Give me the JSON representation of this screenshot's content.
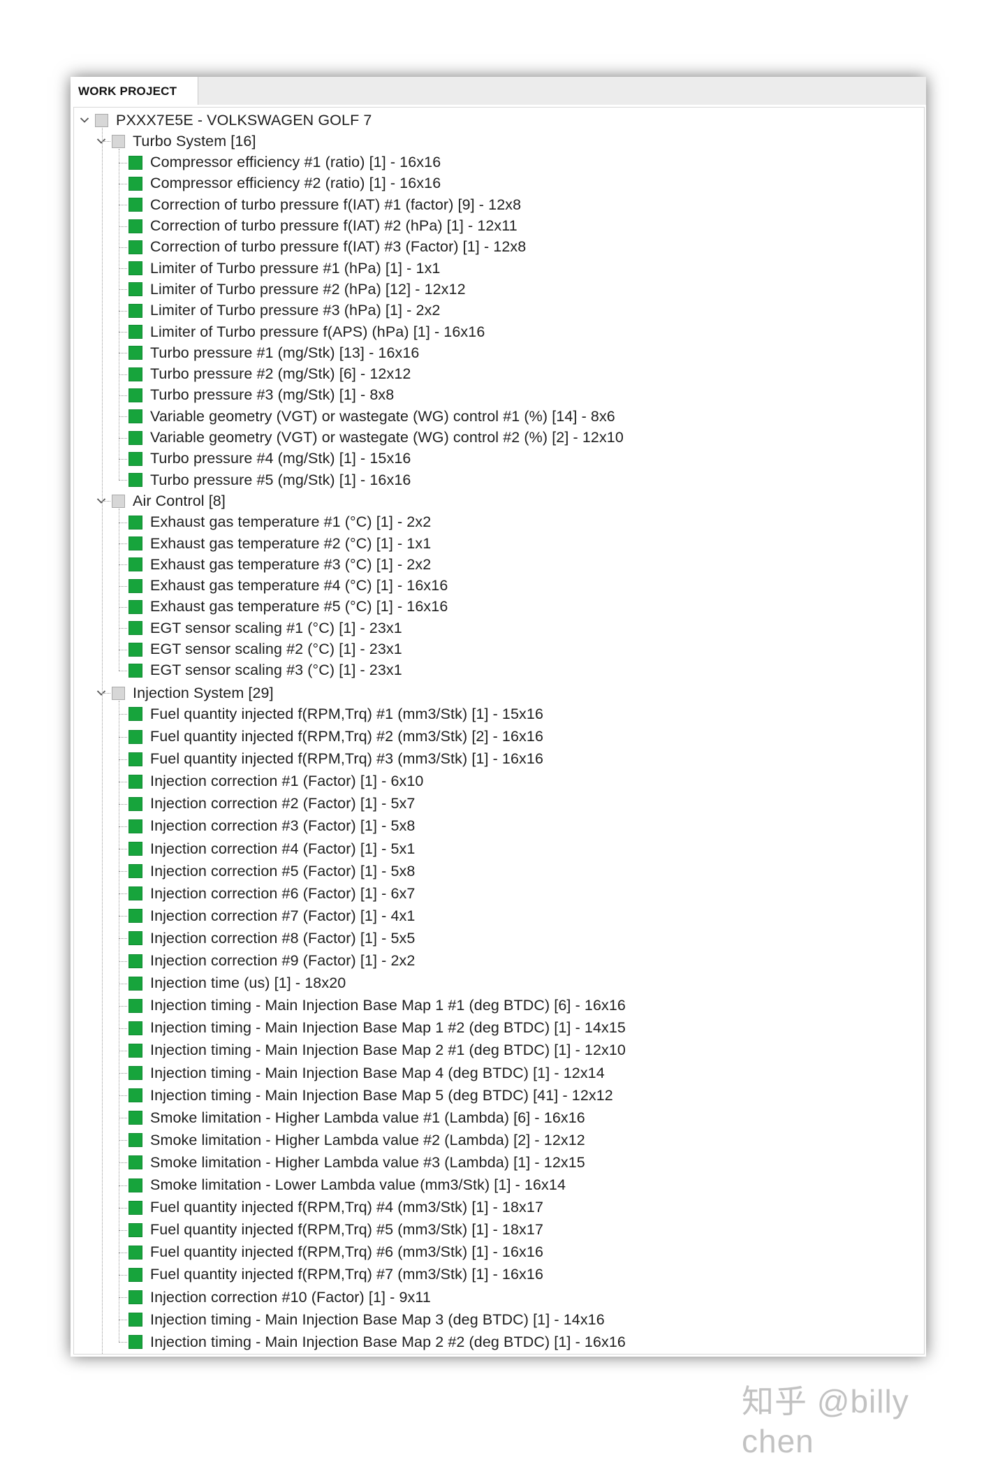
{
  "panel": {
    "tab_label": "WORK PROJECT"
  },
  "tree": {
    "root": {
      "label": "PXXX7E5E - VOLKSWAGEN GOLF 7",
      "expanded": true
    },
    "groups": [
      {
        "label": "Turbo System [16]",
        "expanded": true,
        "items": [
          "Compressor efficiency #1 (ratio) [1] - 16x16",
          "Compressor efficiency #2 (ratio) [1] - 16x16",
          "Correction of turbo pressure f(IAT) #1 (factor) [9] - 12x8",
          "Correction of turbo pressure f(IAT) #2 (hPa) [1] - 12x11",
          "Correction of turbo pressure f(IAT) #3 (Factor) [1] - 12x8",
          "Limiter of Turbo pressure #1 (hPa) [1] - 1x1",
          "Limiter of Turbo pressure #2 (hPa) [12] - 12x12",
          "Limiter of Turbo pressure #3 (hPa) [1] - 2x2",
          "Limiter of Turbo pressure f(APS) (hPa) [1] - 16x16",
          "Turbo pressure #1 (mg/Stk) [13] - 16x16",
          "Turbo pressure #2 (mg/Stk) [6] - 12x12",
          "Turbo pressure #3 (mg/Stk) [1] - 8x8",
          "Variable geometry (VGT) or wastegate (WG) control #1 (%) [14] - 8x6",
          "Variable geometry (VGT) or wastegate (WG) control #2 (%) [2] - 12x10",
          "Turbo pressure #4 (mg/Stk) [1] - 15x16",
          "Turbo pressure #5 (mg/Stk) [1] - 16x16"
        ]
      },
      {
        "label": "Air Control [8]",
        "expanded": true,
        "items": [
          "Exhaust gas temperature #1 (°C) [1] - 2x2",
          "Exhaust gas temperature #2 (°C) [1] - 1x1",
          "Exhaust gas temperature #3 (°C) [1] - 2x2",
          "Exhaust gas temperature #4 (°C) [1] - 16x16",
          "Exhaust gas temperature #5 (°C) [1] - 16x16",
          "EGT sensor scaling #1 (°C) [1] - 23x1",
          "EGT sensor scaling #2 (°C) [1] - 23x1",
          "EGT sensor scaling #3 (°C) [1] - 23x1"
        ]
      },
      {
        "label": "Injection System [29]",
        "expanded": true,
        "items": [
          "Fuel quantity injected f(RPM,Trq) #1 (mm3/Stk) [1] - 15x16",
          "Fuel quantity injected f(RPM,Trq) #2 (mm3/Stk) [2] - 16x16",
          "Fuel quantity injected f(RPM,Trq) #3 (mm3/Stk) [1] - 16x16",
          "Injection correction #1 (Factor) [1] - 6x10",
          "Injection correction #2 (Factor) [1] - 5x7",
          "Injection correction #3 (Factor) [1] - 5x8",
          "Injection correction #4 (Factor) [1] - 5x1",
          "Injection correction #5 (Factor) [1] - 5x8",
          "Injection correction #6 (Factor) [1] - 6x7",
          "Injection correction #7 (Factor) [1] - 4x1",
          "Injection correction #8 (Factor) [1] - 5x5",
          "Injection correction #9 (Factor) [1] - 2x2",
          "Injection time (us) [1] - 18x20",
          "Injection timing - Main Injection Base Map 1 #1 (deg BTDC) [6] - 16x16",
          "Injection timing - Main Injection Base Map 1 #2 (deg BTDC) [1] - 14x15",
          "Injection timing - Main Injection Base Map 2 #1 (deg BTDC) [1] - 12x10",
          "Injection timing - Main Injection Base Map 4 (deg BTDC) [1] - 12x14",
          "Injection timing - Main Injection Base Map 5 (deg BTDC) [41] - 12x12",
          "Smoke limitation - Higher Lambda value #1 (Lambda) [6] - 16x16",
          "Smoke limitation - Higher Lambda value #2 (Lambda) [2] - 12x12",
          "Smoke limitation - Higher Lambda value #3 (Lambda) [1] - 12x15",
          "Smoke limitation - Lower Lambda value (mm3/Stk) [1] - 16x14",
          "Fuel quantity injected f(RPM,Trq) #4 (mm3/Stk) [1] - 18x17",
          "Fuel quantity injected f(RPM,Trq) #5 (mm3/Stk) [1] - 18x17",
          "Fuel quantity injected f(RPM,Trq) #6 (mm3/Stk) [1] - 16x16",
          "Fuel quantity injected f(RPM,Trq) #7 (mm3/Stk) [1] - 16x16",
          "Injection correction #10 (Factor) [1] - 9x11",
          "Injection timing - Main Injection Base Map 3 (deg BTDC) [1] - 14x16",
          "Injection timing - Main Injection Base Map 2 #2 (deg BTDC) [1] - 16x16"
        ]
      }
    ]
  },
  "watermark": "知乎 @billy chen",
  "colors": {
    "item_box": "#17a43c",
    "group_box": "#d7d7d7",
    "shadow": "#000000"
  }
}
